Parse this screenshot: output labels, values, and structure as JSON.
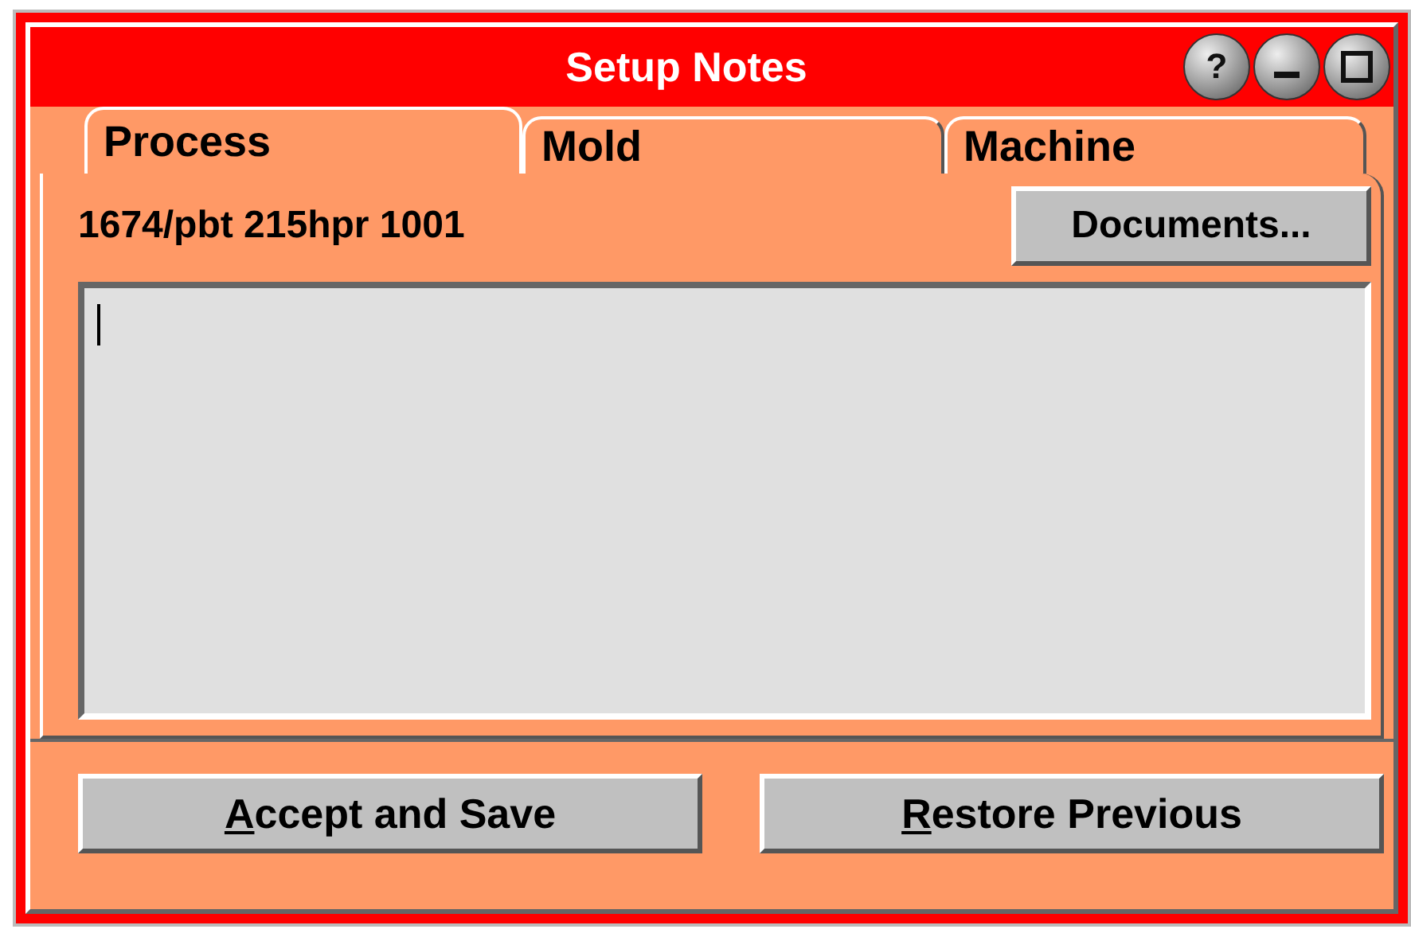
{
  "window": {
    "title": "Setup Notes",
    "buttons": [
      {
        "kind": "help",
        "label": "?"
      },
      {
        "kind": "minimize"
      },
      {
        "kind": "maximize"
      }
    ]
  },
  "tabs": [
    {
      "label": "Process",
      "selected": true
    },
    {
      "label": "Mold",
      "selected": false
    },
    {
      "label": "Machine",
      "selected": false
    }
  ],
  "part_label": "1674/pbt 215hpr 1001",
  "documents_button": "Documents...",
  "notes": {
    "focused": true
  },
  "buttons": [
    {
      "label": "Accept and Save",
      "mnemonic_underlined": true
    },
    {
      "label": "Restore Previous",
      "mnemonic_underlined": true
    }
  ]
}
